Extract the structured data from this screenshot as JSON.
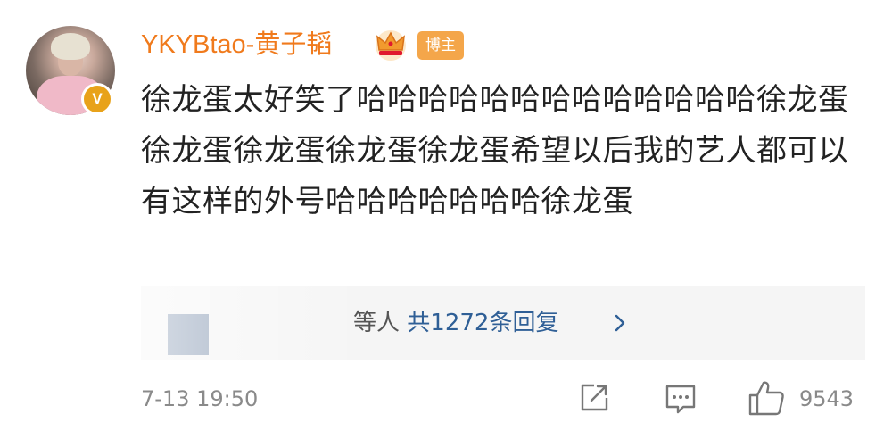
{
  "comment": {
    "username": "YKYBtao-黄子韬",
    "badge_label": "博主",
    "verify_badge": "V",
    "text": "徐龙蛋太好笑了哈哈哈哈哈哈哈哈哈哈哈哈哈徐龙蛋徐龙蛋徐龙蛋徐龙蛋徐龙蛋希望以后我的艺人都可以有这样的外号哈哈哈哈哈哈哈徐龙蛋",
    "timestamp": "7-13 19:50",
    "like_count": "9543"
  },
  "replies": {
    "prefix": "等人",
    "summary": "共1272条回复"
  },
  "icons": {
    "crown": "crown-icon",
    "chevron": "chevron-right-icon",
    "share": "share-icon",
    "comment": "comment-icon",
    "like": "thumbs-up-icon"
  },
  "colors": {
    "username": "#f07a1c",
    "badge": "#f4a64a",
    "link": "#2f5f96",
    "verify": "#e8a21a"
  }
}
